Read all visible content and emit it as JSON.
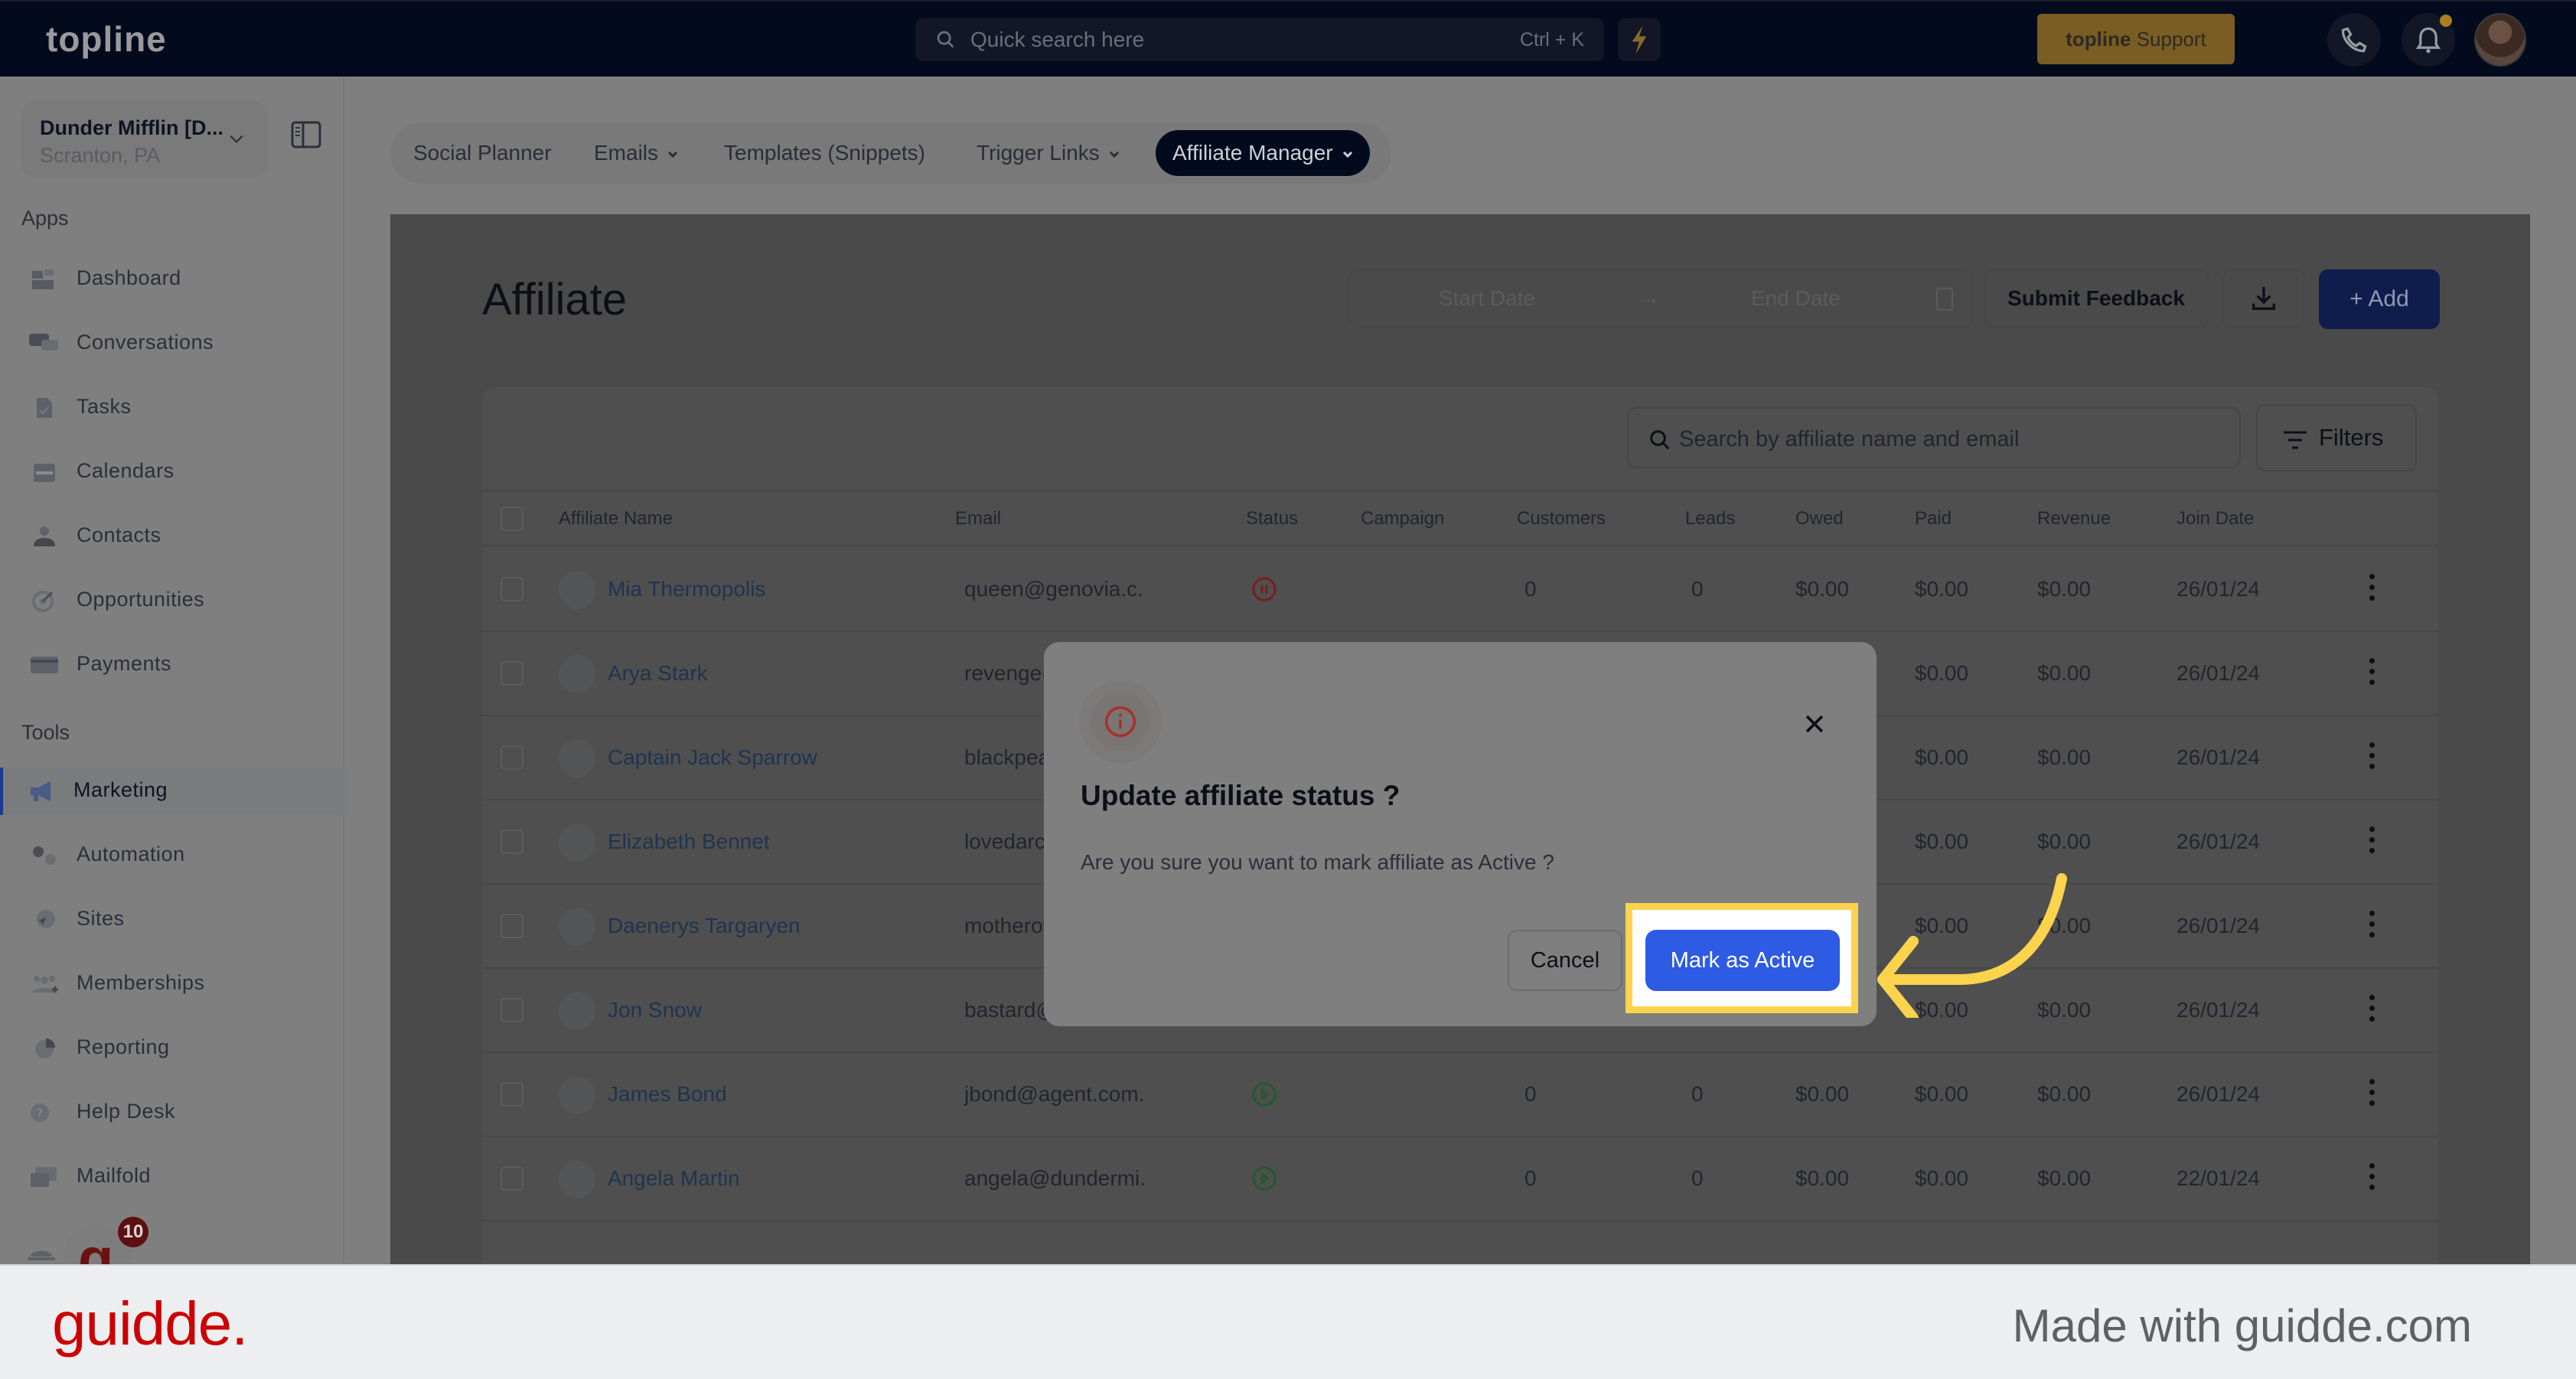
{
  "topbar": {
    "brand": "topline",
    "quick_search_placeholder": "Quick search here",
    "quick_search_shortcut": "Ctrl + K",
    "support_brand": "topline",
    "support_label": "Support",
    "notification_dot_color": "#a8801f"
  },
  "company": {
    "name": "Dunder Mifflin [D...",
    "location": "Scranton, PA"
  },
  "sidebar": {
    "apps_label": "Apps",
    "tools_label": "Tools",
    "apps": [
      {
        "label": "Dashboard",
        "icon": "dashboard-icon"
      },
      {
        "label": "Conversations",
        "icon": "chat-icon"
      },
      {
        "label": "Tasks",
        "icon": "tasks-icon"
      },
      {
        "label": "Calendars",
        "icon": "calendar-icon"
      },
      {
        "label": "Contacts",
        "icon": "contact-icon"
      },
      {
        "label": "Opportunities",
        "icon": "target-icon"
      },
      {
        "label": "Payments",
        "icon": "credit-card-icon"
      }
    ],
    "tools": [
      {
        "label": "Marketing",
        "icon": "megaphone-icon",
        "active": true
      },
      {
        "label": "Automation",
        "icon": "gears-icon"
      },
      {
        "label": "Sites",
        "icon": "globe-cursor-icon"
      },
      {
        "label": "Memberships",
        "icon": "users-plus-icon"
      },
      {
        "label": "Reporting",
        "icon": "pie-chart-icon"
      },
      {
        "label": "Help Desk",
        "icon": "help-icon"
      },
      {
        "label": "Mailfold",
        "icon": "mail-icon"
      }
    ],
    "help_badge_count": "10"
  },
  "tabs": [
    {
      "label": "Social Planner",
      "dropdown": false
    },
    {
      "label": "Emails",
      "dropdown": true
    },
    {
      "label": "Templates (Snippets)",
      "dropdown": false
    },
    {
      "label": "Trigger Links",
      "dropdown": true
    },
    {
      "label": "Affiliate Manager",
      "dropdown": true,
      "active": true
    }
  ],
  "page": {
    "title": "Affiliate",
    "start_date_placeholder": "Start Date",
    "end_date_placeholder": "End Date",
    "date_arrow": "→",
    "submit_feedback": "Submit Feedback",
    "add_label": "Add",
    "search_placeholder": "Search by affiliate name and email",
    "filters_label": "Filters"
  },
  "table": {
    "columns": [
      "Affiliate Name",
      "Email",
      "Status",
      "Campaign",
      "Customers",
      "Leads",
      "Owed",
      "Paid",
      "Revenue",
      "Join Date"
    ],
    "rows": [
      {
        "name": "Mia Thermopolis",
        "email": "queen@genovia.c.",
        "status": "paused",
        "campaign": "",
        "customers": "0",
        "leads": "0",
        "owed": "$0.00",
        "paid": "$0.00",
        "revenue": "$0.00",
        "join_date": "26/01/24"
      },
      {
        "name": "Arya Stark",
        "email": "revenge@",
        "status": "",
        "campaign": "",
        "customers": "",
        "leads": "",
        "owed": "",
        "paid": "$0.00",
        "revenue": "$0.00",
        "join_date": "26/01/24"
      },
      {
        "name": "Captain Jack Sparrow",
        "email": "blackpea",
        "status": "",
        "campaign": "",
        "customers": "",
        "leads": "",
        "owed": "",
        "paid": "$0.00",
        "revenue": "$0.00",
        "join_date": "26/01/24"
      },
      {
        "name": "Elizabeth Bennet",
        "email": "lovedarcy",
        "status": "",
        "campaign": "",
        "customers": "",
        "leads": "",
        "owed": "",
        "paid": "$0.00",
        "revenue": "$0.00",
        "join_date": "26/01/24"
      },
      {
        "name": "Daenerys Targaryen",
        "email": "motherof",
        "status": "",
        "campaign": "",
        "customers": "",
        "leads": "",
        "owed": "",
        "paid": "$0.00",
        "revenue": "$0.00",
        "join_date": "26/01/24"
      },
      {
        "name": "Jon Snow",
        "email": "bastard@",
        "status": "",
        "campaign": "",
        "customers": "",
        "leads": "",
        "owed": "",
        "paid": "$0.00",
        "revenue": "$0.00",
        "join_date": "26/01/24"
      },
      {
        "name": "James Bond",
        "email": "jbond@agent.com.",
        "status": "active",
        "campaign": "",
        "customers": "0",
        "leads": "0",
        "owed": "$0.00",
        "paid": "$0.00",
        "revenue": "$0.00",
        "join_date": "26/01/24"
      },
      {
        "name": "Angela Martin",
        "email": "angela@dundermi.",
        "status": "active",
        "campaign": "",
        "customers": "0",
        "leads": "0",
        "owed": "$0.00",
        "paid": "$0.00",
        "revenue": "$0.00",
        "join_date": "22/01/24"
      }
    ]
  },
  "modal": {
    "title": "Update affiliate status ?",
    "message": "Are you sure you want to mark affiliate as Active ?",
    "cancel_label": "Cancel",
    "confirm_label": "Mark as Active",
    "confirm_color": "#2d5be3",
    "highlight_color": "#fcd34d"
  },
  "footer": {
    "logo": "guidde.",
    "tagline": "Made with guidde.com"
  }
}
